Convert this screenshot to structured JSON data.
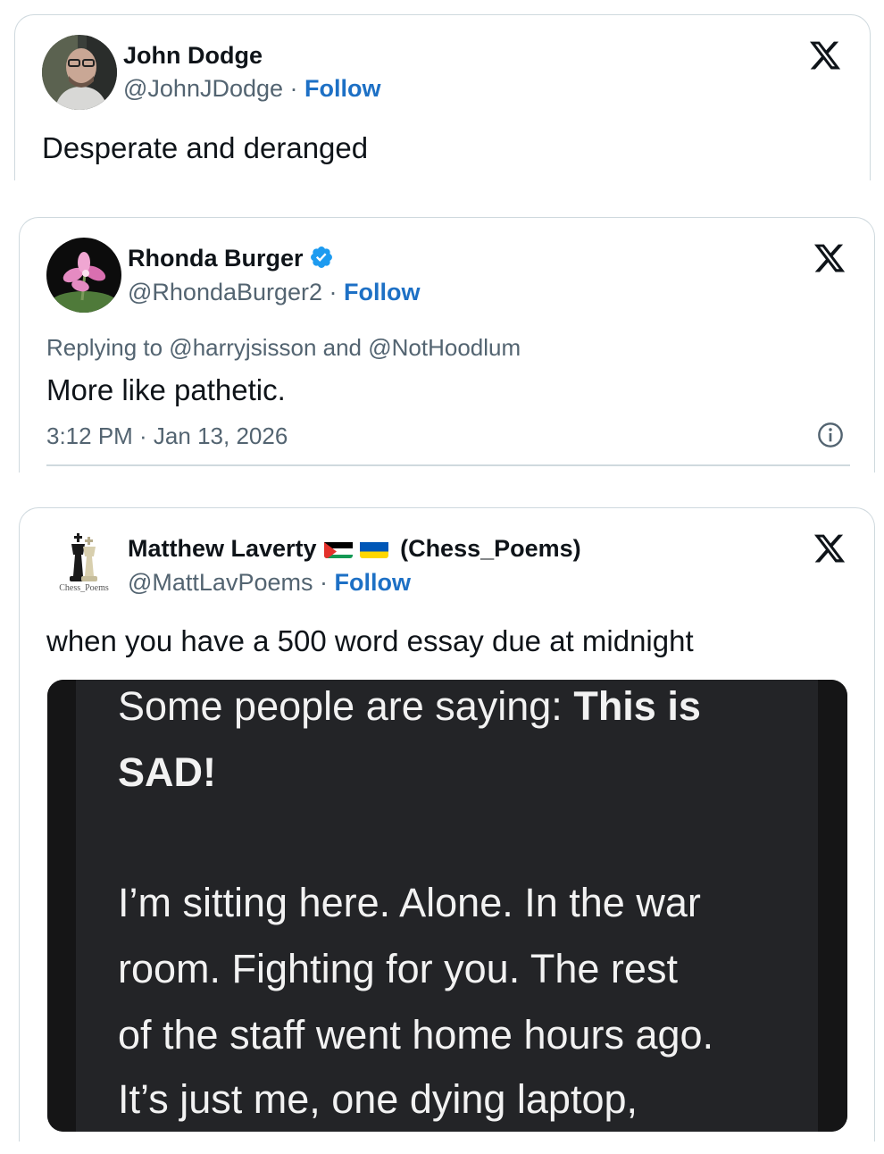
{
  "tweets": [
    {
      "author_name": "John Dodge",
      "handle": "@JohnJDodge",
      "separator": " · ",
      "follow_label": "Follow",
      "text": "Desperate and deranged",
      "avatar_icon": "person-photo-avatar",
      "logo_icon": "x-logo-icon"
    },
    {
      "author_name": "Rhonda Burger",
      "verified": true,
      "handle": "@RhondaBurger2",
      "separator": " · ",
      "follow_label": "Follow",
      "replying_to": "Replying to @harryjsisson and @NotHoodlum",
      "text": "More like pathetic.",
      "timestamp": "3:12 PM · Jan 13, 2026",
      "avatar_icon": "pink-flower-avatar",
      "logo_icon": "x-logo-icon",
      "info_icon": "info-icon"
    },
    {
      "author_name": "Matthew Laverty",
      "name_suffix": "(Chess_Poems)",
      "flags": [
        "palestine-flag-icon",
        "ukraine-flag-icon"
      ],
      "handle": "@MattLavPoems",
      "separator": " · ",
      "follow_label": "Follow",
      "text": "when you have a 500 word essay due at midnight",
      "avatar_icon": "chess-pieces-avatar",
      "avatar_caption": "Chess_Poems",
      "logo_icon": "x-logo-icon",
      "media": {
        "line1_plain": "Some people are saying: ",
        "line1_bold": "This is",
        "line2_bold": "SAD!",
        "lines": [
          "I’m sitting here. Alone. In the war",
          "room. Fighting for you. The rest",
          "of the staff went home hours ago.",
          "It’s just me, one dying laptop,"
        ]
      }
    }
  ],
  "colors": {
    "follow": "#1d70c5",
    "secondary_text": "#536471",
    "verified": "#1d9bf0",
    "border": "#cfd9de",
    "media_bg": "#232427"
  }
}
